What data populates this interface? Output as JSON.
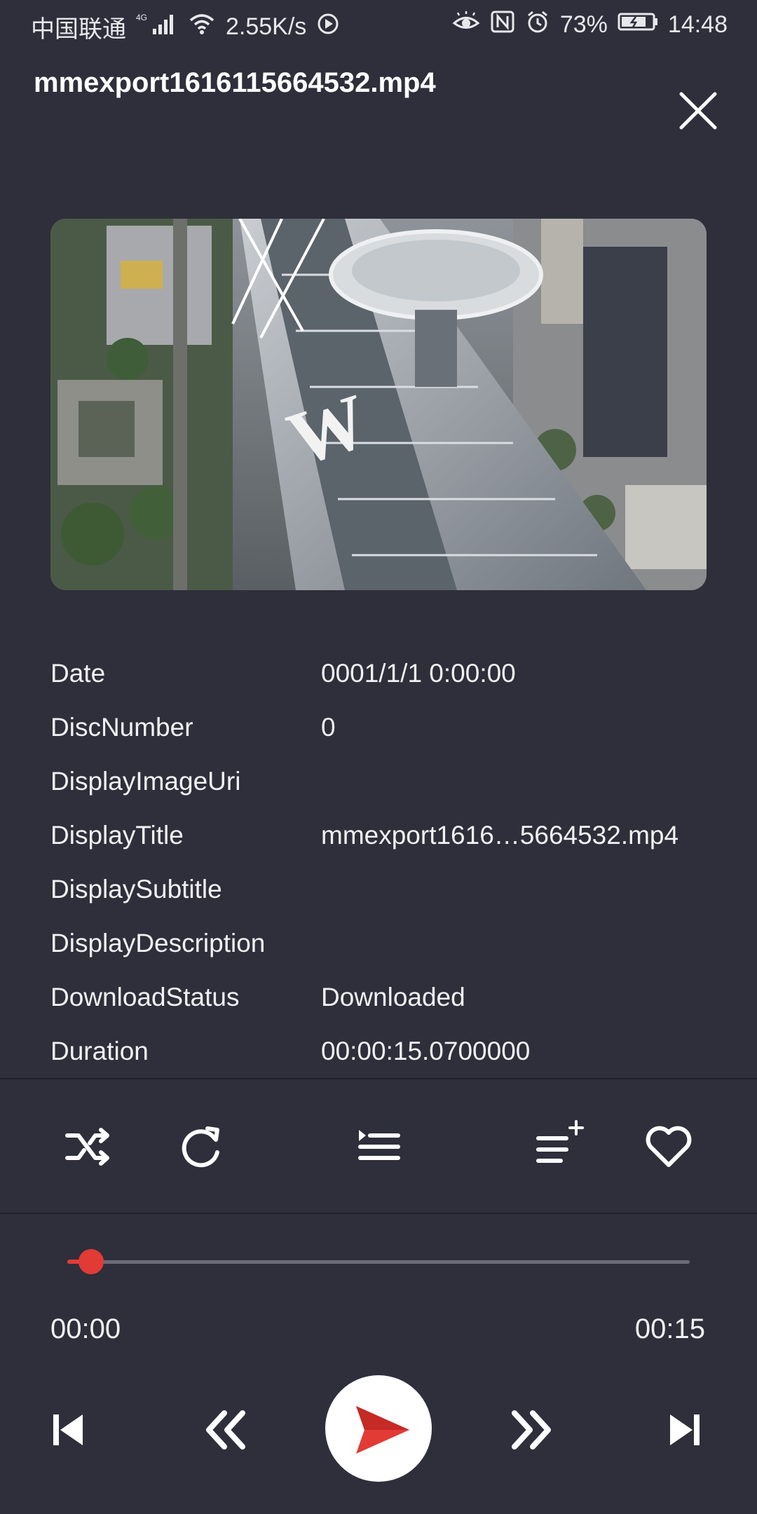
{
  "status_bar": {
    "carrier": "中国联通",
    "network_type": "4G",
    "speed": "2.55K/s",
    "battery": "73%",
    "time": "14:48"
  },
  "header": {
    "title": "mmexport1616115664532.mp4"
  },
  "thumbnail": {
    "logo_text": "W"
  },
  "properties": [
    {
      "key": "Date",
      "value": "0001/1/1 0:00:00"
    },
    {
      "key": "DiscNumber",
      "value": "0"
    },
    {
      "key": "DisplayImageUri",
      "value": ""
    },
    {
      "key": "DisplayTitle",
      "value": "mmexport1616…5664532.mp4"
    },
    {
      "key": "DisplaySubtitle",
      "value": ""
    },
    {
      "key": "DisplayDescription",
      "value": ""
    },
    {
      "key": "DownloadStatus",
      "value": "Downloaded"
    },
    {
      "key": "Duration",
      "value": "00:00:15.0700000"
    }
  ],
  "toolbar": {
    "icons": [
      "shuffle-icon",
      "repeat-icon",
      "queue-icon",
      "add-to-playlist-icon",
      "heart-icon"
    ]
  },
  "player": {
    "current_time": "00:00",
    "total_time": "00:15",
    "progress": 0.0
  },
  "colors": {
    "background": "#2e2f3b",
    "accent": "#e23b36",
    "track": "#6b6c78"
  }
}
